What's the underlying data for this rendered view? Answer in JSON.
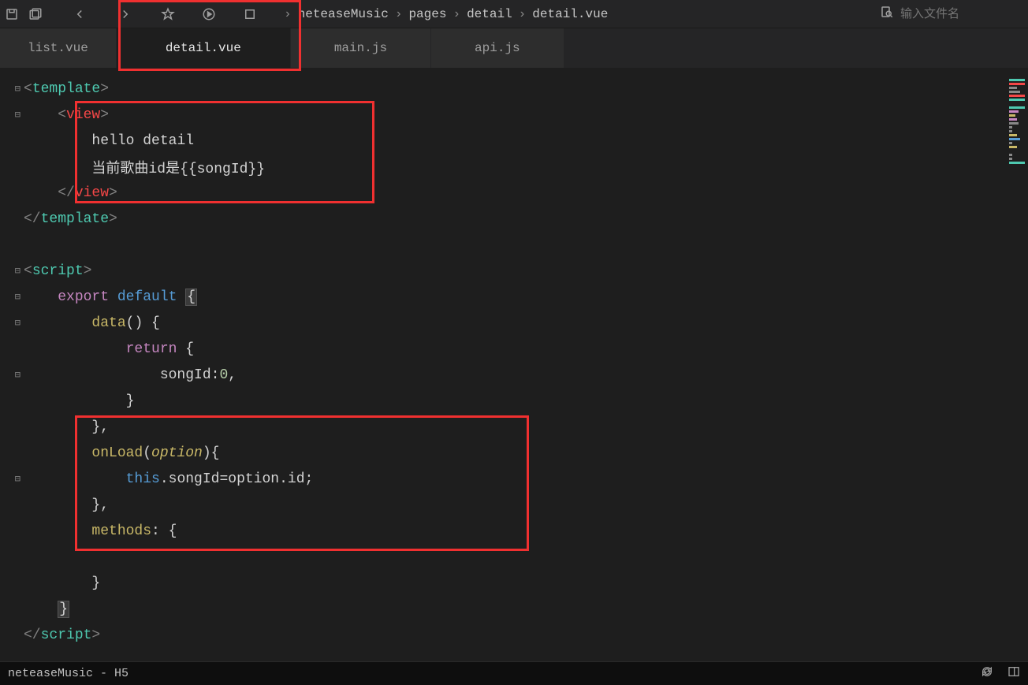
{
  "toolbar": {
    "breadcrumb": [
      "neteaseMusic",
      "pages",
      "detail",
      "detail.vue"
    ],
    "search_placeholder": "输入文件名"
  },
  "tabs": [
    {
      "label": "list.vue",
      "active": false
    },
    {
      "label": "detail.vue",
      "active": true
    },
    {
      "label": "main.js",
      "active": false
    },
    {
      "label": "api.js",
      "active": false
    }
  ],
  "code": {
    "l1_tag": "template",
    "l2_tag": "view",
    "l3_text": "hello detail",
    "l4_text": "当前歌曲id是{{songId}}",
    "l5_tag": "view",
    "l6_tag": "template",
    "l8_tag": "script",
    "l9_kw1": "export",
    "l9_kw2": "default",
    "l9_brace": "{",
    "l10_fn": "data",
    "l10_rest": "() {",
    "l11_kw": "return",
    "l11_brace": " {",
    "l12_prop": "songId",
    "l12_colon": ":",
    "l12_num": "0",
    "l12_comma": ",",
    "l13_brace": "}",
    "l14_brace": "},",
    "l15_fn": "onLoad",
    "l15_paren_o": "(",
    "l15_param": "option",
    "l15_paren_c": "){",
    "l16_this": "this",
    "l16_dot1": ".",
    "l16_prop": "songId",
    "l16_eq": "=",
    "l16_opt": "option",
    "l16_dot2": ".",
    "l16_id": "id",
    "l16_semi": ";",
    "l17_brace": "},",
    "l18_fn": "methods",
    "l18_rest": ": {",
    "l20_brace": "}",
    "l21_brace": "}",
    "l22_tag": "script"
  },
  "statusbar": {
    "text": "neteaseMusic - H5"
  }
}
